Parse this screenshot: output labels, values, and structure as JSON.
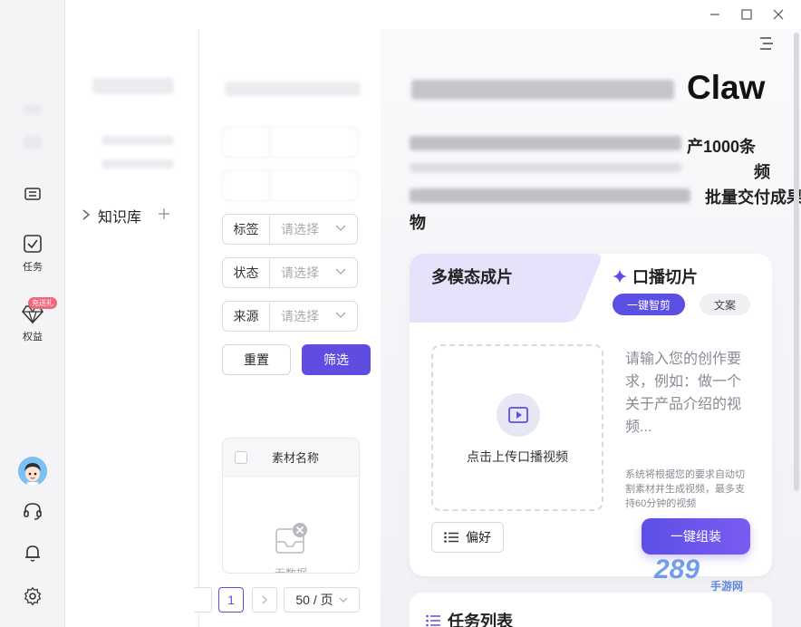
{
  "window": {
    "minimize_icon": "minimize-icon",
    "maximize_icon": "maximize-icon",
    "close_icon": "close-icon"
  },
  "rail": {
    "items": [
      {
        "label": "",
        "icon": "library-icon"
      },
      {
        "label": "任务",
        "icon": "task-checkbox-icon"
      },
      {
        "label": "权益",
        "icon": "diamond-icon",
        "badge": "充送礼"
      }
    ]
  },
  "knowledge": {
    "label": "知识库"
  },
  "filters": {
    "rows": [
      {
        "label": "标签",
        "placeholder": "请选择"
      },
      {
        "label": "状态",
        "placeholder": "请选择"
      },
      {
        "label": "来源",
        "placeholder": "请选择"
      }
    ],
    "reset_label": "重置",
    "filter_label": "筛选",
    "table": {
      "column_name": "素材名称",
      "empty_text": "无数据"
    },
    "pager": {
      "current_page": "1",
      "page_size": "50 / 页"
    }
  },
  "hero": {
    "brand": "Claw",
    "line1_visible": "产1000条",
    "line2_visible": "频",
    "line3_visible": "批量交付成果",
    "line4_visible": "物"
  },
  "card": {
    "tab_multimodal": "多模态成片",
    "tab_talking": "口播切片",
    "chip_active": "一键智剪",
    "chip_copy": "文案",
    "upload_text": "点击上传口播视频",
    "prompt": "请输入您的创作要求，例如：做一个关于产品介绍的视频...",
    "hint": "系统将根据您的要求自动切割素材并生成视频，最多支持60分钟的视频",
    "pref_label": "偏好",
    "assemble_label": "一键组装"
  },
  "tasks": {
    "title": "任务列表"
  },
  "watermark": {
    "brand": "289",
    "sub": "手游网"
  },
  "colors": {
    "accent": "#5e4de0",
    "tab_bg": "#e5e3fb",
    "badge": "#f0687a"
  }
}
